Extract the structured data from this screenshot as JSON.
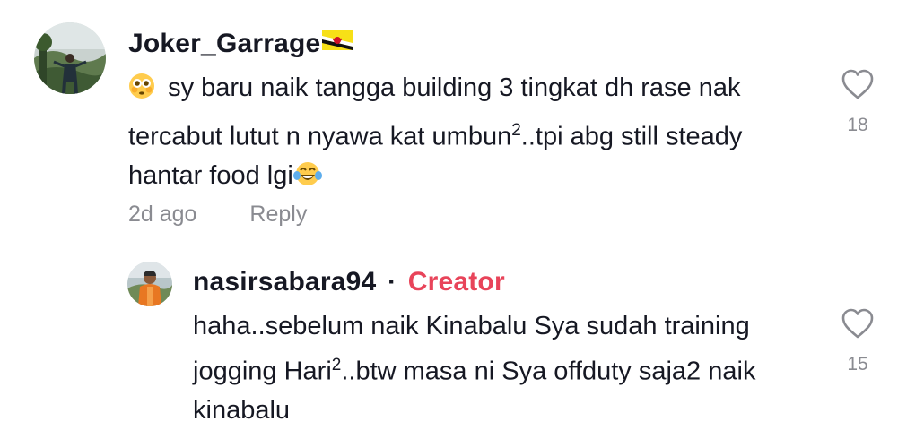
{
  "comment": {
    "username": "Joker_Garrage",
    "flag_emoji": "brunei-flag",
    "text_line1": "sy baru naik tangga building 3 tingkat dh rase nak",
    "text_line2_a": "tercabut lutut n nyawa kat umbun",
    "text_line2_sup": "2",
    "text_line2_b": "..tpi abg still steady",
    "text_line3": "hantar food lgi",
    "lead_emoji": "flushed-face",
    "trail_emoji": "tears-of-joy",
    "time": "2d ago",
    "reply_label": "Reply",
    "like_count": "18"
  },
  "reply": {
    "username": "nasirsabara94",
    "separator": "·",
    "badge": "Creator",
    "badge_color": "#e8445a",
    "text_line1": "haha..sebelum naik Kinabalu Sya sudah training",
    "text_line2_a": "jogging Hari",
    "text_line2_sup": "2",
    "text_line2_b": "..btw masa ni Sya offduty saja2 naik",
    "text_line3": "kinabalu",
    "like_count": "15"
  }
}
